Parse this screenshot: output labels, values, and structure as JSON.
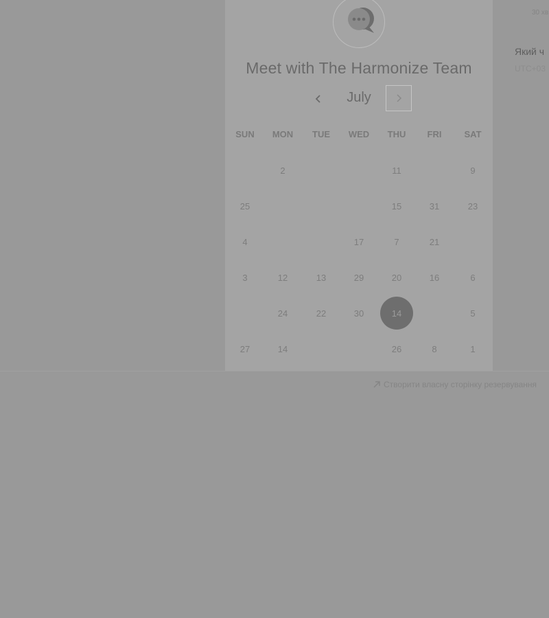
{
  "booking": {
    "title": "Meet with The Harmonize Team",
    "month": "July",
    "weekdays": [
      "SUN",
      "MON",
      "TUE",
      "WED",
      "THU",
      "FRI",
      "SAT"
    ],
    "days": [
      {
        "label": "2",
        "col": 1,
        "row": 0
      },
      {
        "label": "11",
        "col": 4,
        "row": 0
      },
      {
        "label": "9",
        "col": 6,
        "row": 0
      },
      {
        "label": "25",
        "col": 0,
        "row": 1
      },
      {
        "label": "15",
        "col": 4,
        "row": 1
      },
      {
        "label": "31",
        "col": 5,
        "row": 1
      },
      {
        "label": "23",
        "col": 6,
        "row": 1
      },
      {
        "label": "4",
        "col": 0,
        "row": 2
      },
      {
        "label": "17",
        "col": 3,
        "row": 2
      },
      {
        "label": "7",
        "col": 4,
        "row": 2
      },
      {
        "label": "21",
        "col": 5,
        "row": 2
      },
      {
        "label": "3",
        "col": 0,
        "row": 3
      },
      {
        "label": "12",
        "col": 1,
        "row": 3
      },
      {
        "label": "13",
        "col": 2,
        "row": 3
      },
      {
        "label": "29",
        "col": 3,
        "row": 3
      },
      {
        "label": "20",
        "col": 4,
        "row": 3
      },
      {
        "label": "16",
        "col": 5,
        "row": 3
      },
      {
        "label": "6",
        "col": 6,
        "row": 3
      },
      {
        "label": "24",
        "col": 1,
        "row": 4
      },
      {
        "label": "22",
        "col": 2,
        "row": 4
      },
      {
        "label": "30",
        "col": 3,
        "row": 4
      },
      {
        "label": "14",
        "col": 4,
        "row": 4,
        "selected": true
      },
      {
        "label": "5",
        "col": 6,
        "row": 4
      },
      {
        "label": "27",
        "col": 0,
        "row": 5
      },
      {
        "label": "14",
        "col": 1,
        "row": 5
      },
      {
        "label": "26",
        "col": 4,
        "row": 5
      },
      {
        "label": "8",
        "col": 5,
        "row": 5
      },
      {
        "label": "1",
        "col": 6,
        "row": 5
      }
    ]
  },
  "side_panel": {
    "duration": "30 хв",
    "question": "Який ч",
    "time": "UTC+03"
  },
  "footer": {
    "create_link": "Створити власну сторінку резервування"
  },
  "icons": {
    "avatar": "chat-bubble-icon",
    "prev": "chevron-left-icon",
    "next": "chevron-right-icon",
    "link": "external-link-icon"
  }
}
